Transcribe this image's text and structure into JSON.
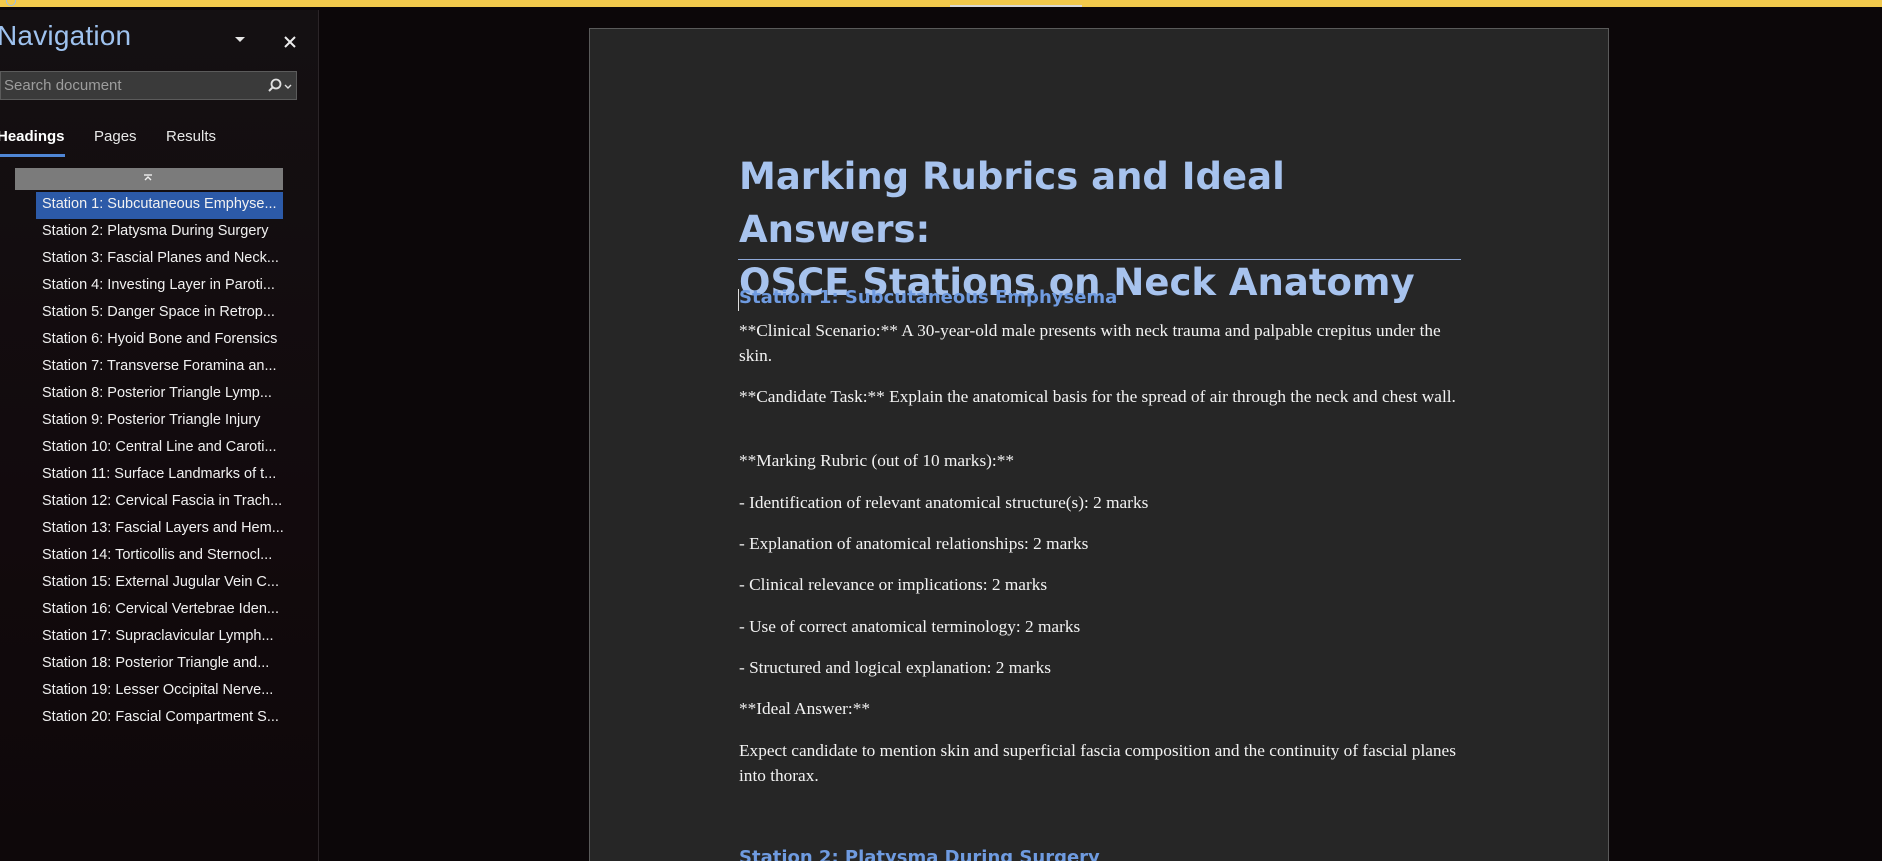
{
  "app": {
    "topbar_color": "#f2c94c",
    "accent": "#4f86d6"
  },
  "nav": {
    "title": "Navigation",
    "search_placeholder": "Search document",
    "tabs": [
      {
        "label": "Headings",
        "active": true
      },
      {
        "label": "Pages",
        "active": false
      },
      {
        "label": "Results",
        "active": false
      }
    ],
    "headings": [
      "Station 1: Subcutaneous Emphyse...",
      "Station 2: Platysma During Surgery",
      "Station 3: Fascial Planes and Neck...",
      "Station 4: Investing Layer in Paroti...",
      "Station 5: Danger Space in Retrop...",
      "Station 6: Hyoid Bone and Forensics",
      "Station 7: Transverse Foramina an...",
      "Station 8: Posterior Triangle Lymp...",
      "Station 9: Posterior Triangle Injury",
      "Station 10: Central Line and Caroti...",
      "Station 11: Surface Landmarks of t...",
      "Station 12: Cervical Fascia in Trach...",
      "Station 13: Fascial Layers and Hem...",
      "Station 14: Torticollis and Sternocl...",
      "Station 15: External Jugular Vein C...",
      "Station 16: Cervical Vertebrae Iden...",
      "Station 17: Supraclavicular Lymph...",
      "Station 18: Posterior Triangle and...",
      "Station 19: Lesser Occipital Nerve...",
      "Station 20: Fascial Compartment S..."
    ],
    "selected_index": 0
  },
  "document": {
    "title_line1": "Marking Rubrics and Ideal Answers:",
    "title_line2": "OSCE Stations on Neck Anatomy",
    "station1_heading": "Station 1: Subcutaneous Emphysema",
    "clinical_scenario": "**Clinical Scenario:** A 30-year-old male presents with neck trauma and palpable crepitus under the skin.",
    "candidate_task": "**Candidate Task:** Explain the anatomical basis for the spread of air through the neck and chest wall.",
    "marking_rubric_label": "**Marking Rubric (out of 10 marks):**",
    "rubric_items": [
      "- Identification of relevant anatomical structure(s): 2 marks",
      "- Explanation of anatomical relationships: 2 marks",
      "- Clinical relevance or implications: 2 marks",
      "- Use of correct anatomical terminology: 2 marks",
      "- Structured and logical explanation: 2 marks"
    ],
    "ideal_answer_label": "**Ideal Answer:**",
    "ideal_answer": "Expect candidate to mention skin and superficial fascia composition and the continuity of fascial planes into thorax.",
    "station2_heading": "Station 2: Platysma During Surgery"
  }
}
